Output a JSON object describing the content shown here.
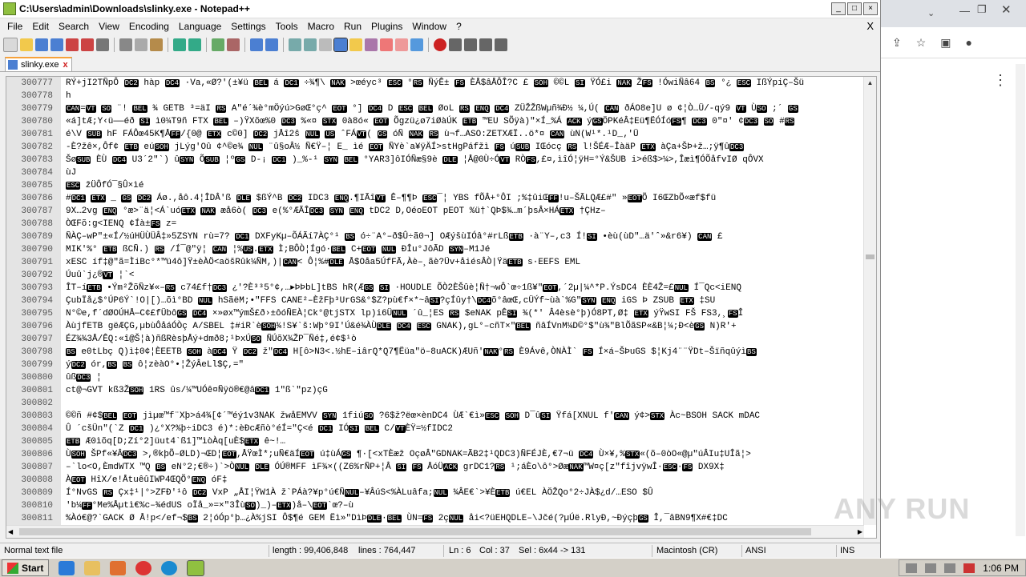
{
  "window": {
    "title": "C:\\Users\\admin\\Downloads\\slinky.exe - Notepad++",
    "buttons": [
      "_",
      "□",
      "×"
    ]
  },
  "menu": [
    "File",
    "Edit",
    "Search",
    "View",
    "Encoding",
    "Language",
    "Settings",
    "Tools",
    "Macro",
    "Run",
    "Plugins",
    "Window",
    "?"
  ],
  "menu_close": "X",
  "tab": {
    "label": "slinky.exe",
    "close": "x"
  },
  "editor": {
    "lines": [
      {
        "n": "300777",
        "text": "RÝ+jI2TÑpÔ DC2 hàp DC4 ·Va,«Ø?'(±¥ü BEL á DC1 ÷¾¶\\ NAK >œéyc³ ESC °RS ÑýÊ± FS ÈÅ$âÅÔÎ?C £ SOH ©©L SI ŸÓ£i NAK ŽFS !ÓwiÑâ64 BS °¿ ESC IßÝpiÇ–Šü"
      },
      {
        "n": "300778",
        "text": "h"
      },
      {
        "n": "300779",
        "text": "CAN=VT SO ¨! BEL ¾ GETB ³=äI RS A\"é´¾è°mÖýú>GøŒ°ç^ EOT °] DC4 D ESC BEL ØoL RS ENQ DC4 ZÜŽŽßWµñ¾Ð½ ¼,Ú( CAN ðÁO8e]U ø ¢¦Ò…Ü/-qý9 VT ÙSO ;´ GS"
      },
      {
        "n": "300780",
        "text": "«á]tÆ;Y‹ü——éð SI ì0¼T9ñ FTX BEL –)ŸXõœ%0 DC3 %«¤ STX 0à8ó« EOT Õgzü¿ø7iØàÚK ETB ™EU SÕÿà)\"×Í_%Á ACK ýGSÖPKéÂ‡Eü¶ËÓÍóFS¶ DC3 0\"¤' ¢DC3 SO #RS"
      },
      {
        "n": "300781",
        "text": "é\\V SUB hF FÁÔœ45K¶ÅFF/{0@ ETX c©0] DC2 jÅî2ŝ NUL US ˆFÁVT( GS óÑ NAK RS ù¬f…ASO:ZETXÆÏ..ö*¤ CAN ùN(W¹*.¹D_‚'Ü"
      },
      {
        "n": "300782",
        "text": "-È?žê×,Ôf¢ ETB eúSOH jLýg'Oû ¢^©e¾ NUL ¨û§oÂ½ Ñ€Ÿ–¦ E_ ìé EOT ÑYè`a¥ÿÄÍ>stHgPáfžì FS úSUB IŒócç RS l!ŠÉÆ–ÎàäP ETX àÇa+ŠÞ+ž…;ÿ¶ûDC3"
      },
      {
        "n": "300783",
        "text": "ŠøSUB ÈÙ DC4 U3´2\"`) ûSYN ÕSUB ¦ºGS D-¡ DC1 )_%-¹ SYN BEL °YAR3]ôIÓÑæ§9è DLE ¦Å@0Ù÷ÓVT RÒFS,£¤,ìîÓ¦ÿH=°Ý&ŠUB i>éß$>¼>,Îæì¶ÓÕåfvIØ   qÔVX"
      },
      {
        "n": "300784",
        "text": "ùJ"
      },
      {
        "n": "300785",
        "text": "ESC žÜÔfÓ¯§Û×ìé"
      },
      {
        "n": "300786",
        "text": "#DC1 ETX    _ GS DC2 Áø.,åô.4¦ÎDÂ'ß DLE $ßÝ^B DC2 IDC3 ENQ.¶IÃîVT Ê–¶¶Þ ESC¯¦ YBS fÕÂ+°ÔI   ;%‡ûiŒFF!u–ŠÃLQÆ£#\" »EOTÕ I6ŒZbÕ«æf$fü"
      },
      {
        "n": "300787",
        "text": "9X…2vg ENQ °æ>¨ä¦<Á`uóETX NAK æå6ò( DC3 e(%°ÆÃÎDC3 SYN ENQ tDC2 D,OéoEOT pEOT %ü†`QÞ$¾…m´þsÂ×HÁETX †ÇHz–"
      },
      {
        "n": "300788",
        "text": "ÒŒFõ:g<IENQ ¢Íà±FS z="
      },
      {
        "n": "300789",
        "text": "ÑÀÇ–wP\"±«Í/½úHÜÙÜÂ‡»5ZSYN rù=7? DC1 DXFyKµ–ÕÁÃí7ÀÇ°¹ BS ó÷¨A°–ð$Û÷ã0¬] OÆýšùIÓâ°#rLßETB ·à¨Y–,c3  Í!SI •èù(ùD\"…ä'ˆ»&r6¥) CAN £"
      },
      {
        "n": "300790",
        "text": "MIK'%° ETB ßCÑ.) RS /Í¯@\"ÿ¦ CAN ¦%US.ETX Ì;BÔÒ¦Ígó·BEL C+EOT NUL ÐÎu°JôÃD SYN–M1Jé"
      },
      {
        "n": "300791",
        "text": "xESC íf‡@\"ã=ÌiBc°*™ü4ô]Ÿ±èÀÖ<aöšRûk¼ÑM,)|CAN< Ô¦%#DLE Å$Oåa5ÚfFÃ,Àè–¸ãè?Üv+åiésÂÒ|ŸäETB s·EEFS EML"
      },
      {
        "n": "300792",
        "text": "Úuû`j¿®VT ¦`<"
      },
      {
        "n": "300793",
        "text": "ÎT–íETB •Ým²ŽõÑz¥«–RS c74£f†DC3 ¿'?È³³5°¢,…▸ÞÞbL]tBS hR(ÆGS SI ·HOUDLE ÕÒ2ÈŠûè¦Ñ†¬wÔ`œ÷1ß¥\"EOT,´2µ|¼^*P.ÝsDC4 ÈÈ4Ž=£NUL Í¯Qc<iENQ"
      },
      {
        "n": "300794",
        "text": "ÇubÏå¿$°ÚP6Ý`!O|[)…õì°BD     NUL hSãëM;•\"FFS CANE²–ÈžFþ³UrGS&°$Z?pù€f×*~âSI?çÍûy†\\DC4õ°âœŒ,cÜÝf~ùà`%G\"SYN ENQ iGS Þ  ZSUB ETX ‡SU"
      },
      {
        "n": "300795",
        "text": "N°©e,f´dØOÚHÅ—C¢£fÜbôGS DC4 ×»øx™ýmŠ£ð›±ôóÑEÀ¦Ck°@tjSTX lp)i6ÜNUL ´û_¦ES RS $eNAK pÊSI ¾(*'  Â4èsè°þ)Ó8PT,Ø‡  ETX ýŸwSI FŠ  FS3,¸FSÎ"
      },
      {
        "n": "300796",
        "text": "ÀùjfETB gëÆÇG,µbùÔåáÓÒç A/SBEL ‡#iR`èSOH¾!S¥`š:Wþ°9I'Ú&é¾ÀÙDLE DC4 ESC GNAK),gL°–cñT×\"BEL ñâÍVnM¼D©°$\"ù¾\"BlÕãSP«&B¦¼;Ð<èGS N)R'+"
      },
      {
        "n": "300797",
        "text": "ÉZ¾¾3Å/ÊQ:«î@Š¦à)ñßRèsþÅý+dmð8;¹ÞxÚSO ÑÚõX¾ŽP¯Ñé‡,é¢$¹ò"
      },
      {
        "n": "300798",
        "text": "BS e0tLbç Q)ì‡0¢¦ÈEETB SOH àDC4 Ÿ DC2 ž\"DC4 H[ô>N3<.½hE–iârQ*Q7¶Ëüa\"ö–8uACK)ÆUñ'NAK°RS È9Ávê,ÒNÀÌ` FS Í×á–ŠÞuGS $¦Kj4¨¨ŸDt–ŠïñqûýìBS"
      },
      {
        "n": "300799",
        "text": "ýDC2 ór,BS BS ô¦zèàO°•¦ŽýÂeLl$Ç,=\""
      },
      {
        "n": "300800",
        "text": "ûßDC3 ¦"
      },
      {
        "n": "300801",
        "text": "ct@¬GVT kß3ŽSOH 1RS ûs/¼™UÓê¤Ñÿö®€@âDC1 1\"ß`\"pz)çG"
      },
      {
        "n": "300802",
        "text": ""
      },
      {
        "n": "300803",
        "text": "©©ñ #¢$BEL EOT jìµœ™f¨Xþ>á4¾[¢´™éý1v3NAK žwåEMVV SYN 1fiúSO ?6$ž?ëœ×ènDC4 ÙÆ`€ì»ESC SOH D¯ûSI Ÿfá[XNUL f'CAN ý¢>STX Àc~BSOH SACK mDAC"
      },
      {
        "n": "300804",
        "text": "Û   ´cšÜn\"(`Z DC1 )¿°X?%þ÷iDC3 é)*:èÐcÆñò°éÍ=\"Ç<é DC1 IÓSI BEL C/VTÈŸ=½fIDC2"
      },
      {
        "n": "300805",
        "text": "ETB Æ0ìõq[D;Zí°2]üut4`ß1]™ìòÀq[uÈ$ETX ê~!…"
      },
      {
        "n": "300806",
        "text": "ÙSOH ŠPf«¥ÂDC3 >,®kþÕ–ØLD)¬ŒD¦EOT,ÅŸœÌ*;uÑ€äÍEOT ú‡ùÁGS ¶·[<xTÈæž  OçøÂ\"GDNAK=ÃB2‡¹QDC3)ÑFÉJÈ,€7¬ü DC4 Ù×¥,%STX«(õ–0òO«@µ\"úÂIu‡UÎã¦>"
      },
      {
        "n": "300807",
        "text": "–`lo<O,ÈmdWTX ™Q BS eN°2;€®÷)`>ÒNUL DLE ÓÚ®MFF ìF¾×((Z6%rÑP+¦Â  SI FS ÅóÜACK grDC1?RS ¹;áÈo\\ô°>ØæNAK™W¤ç[z\"fîjvÿwÎ·ESC·FS DX9X‡"
      },
      {
        "n": "300808",
        "text": "ÀEOT HîX/e!ÅtuêûIWP4ŒQÕ°ENQ óF‡"
      },
      {
        "n": "300809",
        "text": "Í°NvGS RS Çx‡¹|°>ZFÐ'¹ô DC2 VxP „ÅI¦ŸW1À  ž`PÁà?¥p°ú€ÑNUL–¥ÂúS<%ÀLuâfa;NUL ¾ÂE€`>¥ÈETB ú€EL  ÀÖŽQo°2÷JÀ$¿d/…ESO $Û"
      },
      {
        "n": "300810",
        "text": "'b¼FF°Me%Åµtì€%c–¾édUS oÏå_»=×\"3ÎùSO)_)–ETX)å–\\EOT`œ?–ù"
      },
      {
        "n": "300811",
        "text": "%Àó€@?`GACK Ø Å!p</ef¬$BS 2¦óÓp°þ…¿À%jSI Ô$¶é  GEM Ëì»\"DìÞDLE·BEL ÙN=FS 2çNUL åi<?üEHQDLE–\\Jčé(?µÚë.RlyÐ,~ÐýçþGS Î,¯âBN9¶X#€‡DC"
      }
    ]
  },
  "status": {
    "file_type": "Normal text file",
    "length": "length : 99,406,848",
    "lines": "lines : 764,447",
    "ln": "Ln : 6",
    "col": "Col : 37",
    "sel": "Sel : 6x44 -> 131",
    "eol": "Macintosh (CR)",
    "encoding": "ANSI",
    "mode": "INS"
  },
  "taskbar": {
    "start": "Start",
    "time": "1:06 PM"
  },
  "watermark": "ANY RUN",
  "colors": {
    "tab_accent": "#f7a23b",
    "gutter": "#e4e4e4",
    "control_char_bg": "#000000"
  }
}
